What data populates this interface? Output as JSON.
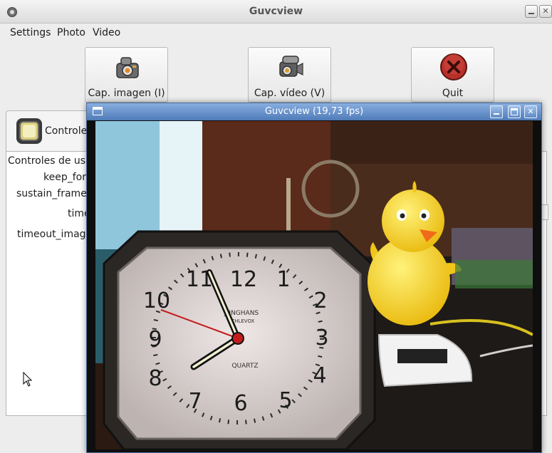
{
  "window": {
    "title": "Guvcview"
  },
  "menu": {
    "items": [
      "Settings",
      "Photo",
      "Video"
    ]
  },
  "toolbar": {
    "capture_image_label": "Cap. imagen (I)",
    "capture_video_label": "Cap. vídeo (V)",
    "quit_label": "Quit"
  },
  "tab": {
    "label": "Controles"
  },
  "controls": {
    "heading": "Controles de usu",
    "labels": [
      "keep_for",
      "sustain_frame",
      "time",
      "timeout_image"
    ]
  },
  "preview": {
    "title": "Guvcview  (19,73 fps)"
  },
  "clock": {
    "numerals": [
      "12",
      "1",
      "2",
      "3",
      "4",
      "5",
      "6",
      "7",
      "8",
      "9",
      "10",
      "11"
    ],
    "brand": "JUNGHANS",
    "model": "ATHLEVOX",
    "movement": "QUARTZ"
  },
  "colors": {
    "preview_titlebar": "#5a86c2",
    "window_bg": "#ededed",
    "quit_red": "#b8302a",
    "duck_yellow": "#f5d21a"
  },
  "icons": {
    "capture_image": "camera-icon",
    "capture_video": "video-camera-icon",
    "quit": "quit-x-icon",
    "tab": "webcam-icon"
  }
}
